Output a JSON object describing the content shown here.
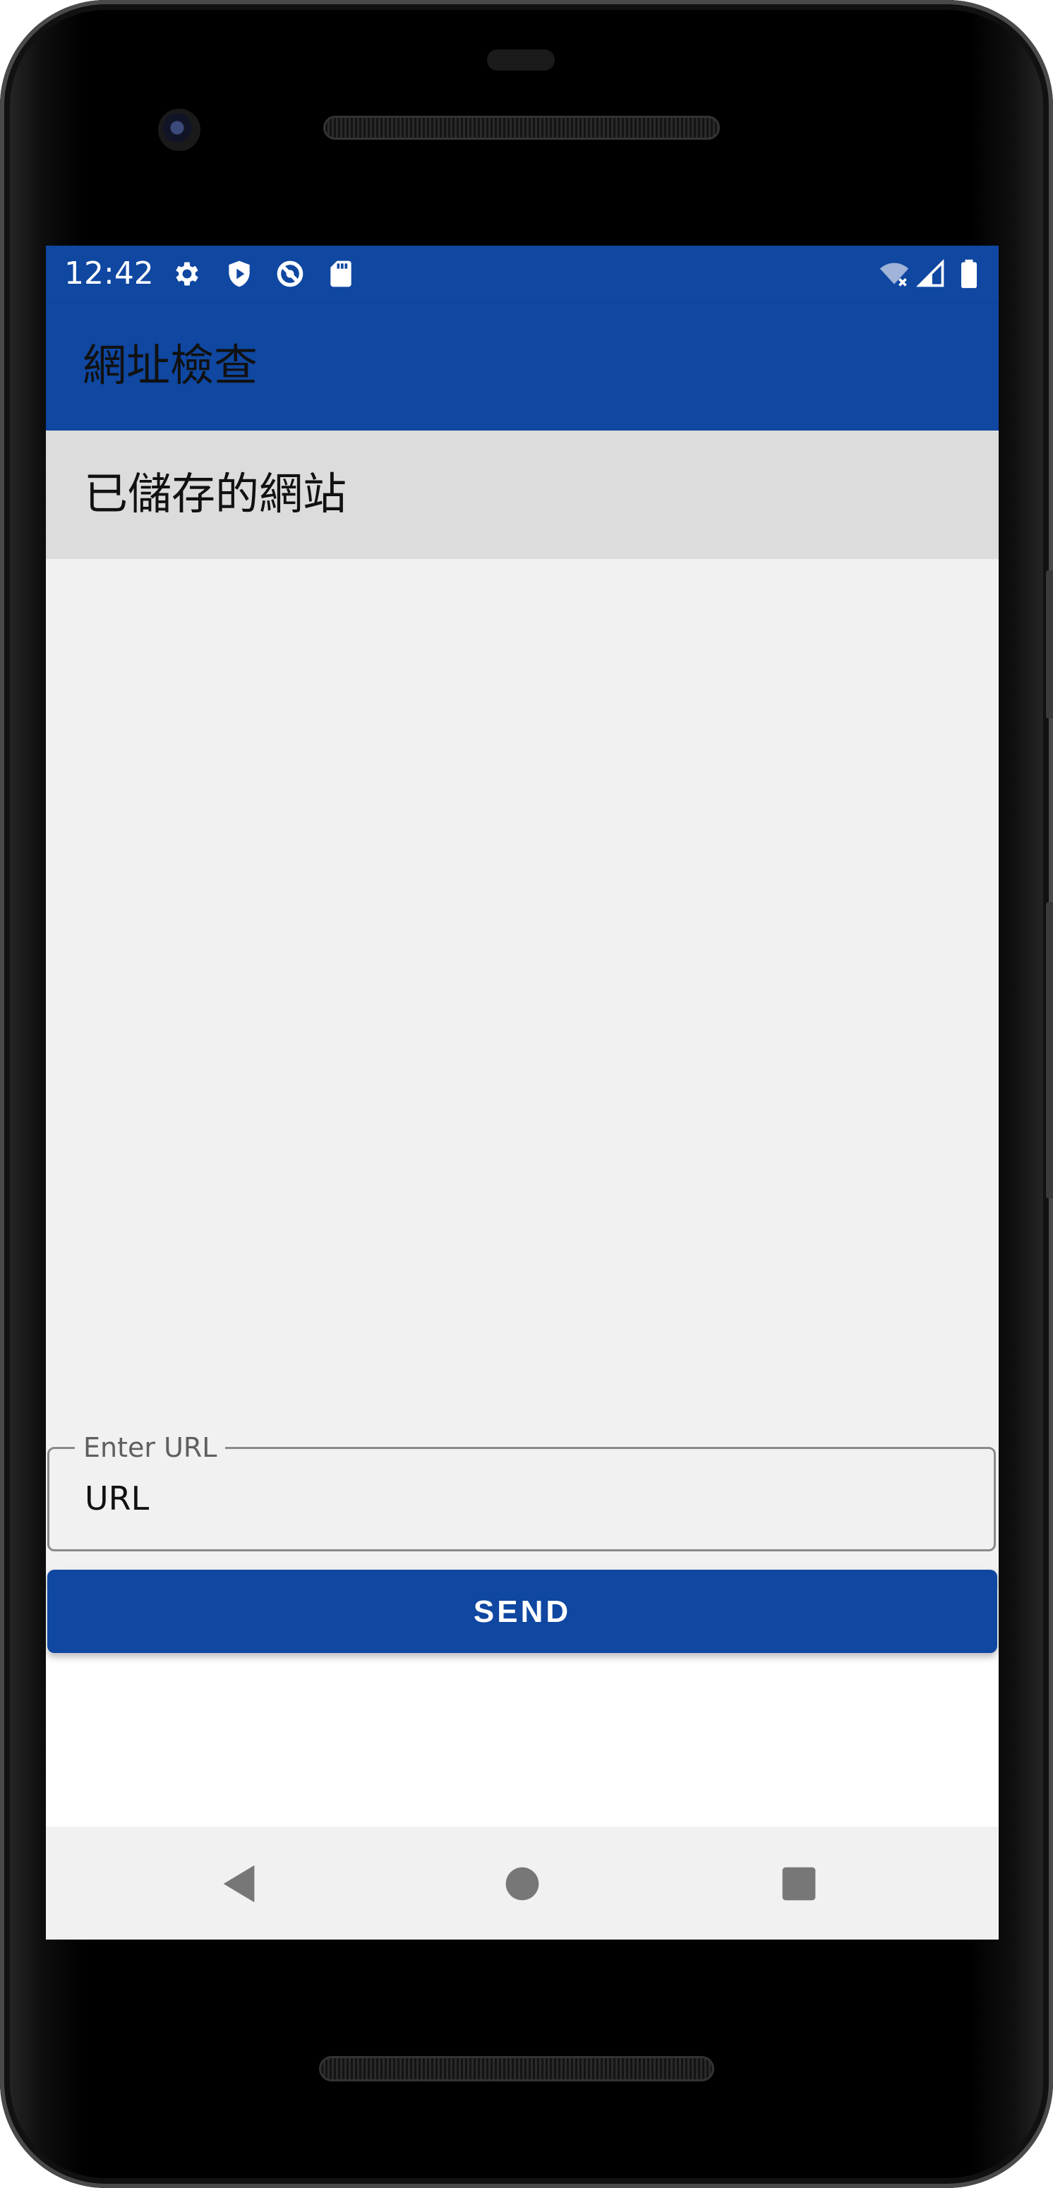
{
  "status_bar": {
    "time": "12:42",
    "left_icons": [
      "settings-icon",
      "shield-play-icon",
      "data-saver-icon",
      "sd-card-icon"
    ],
    "right_icons": [
      "wifi-icon",
      "cellular-signal-icon",
      "battery-icon"
    ]
  },
  "app_bar": {
    "title": "網址檢查"
  },
  "saved_sites": {
    "header": "已儲存的網站",
    "items": []
  },
  "url_form": {
    "label": "Enter URL",
    "value": "URL",
    "send_label": "SEND"
  },
  "nav_bar": {
    "icons": [
      "back-icon",
      "home-icon",
      "recents-icon"
    ]
  },
  "colors": {
    "primary": "#0f47a1",
    "header_bg": "#dcdcdc",
    "list_bg": "#f1f1f1",
    "text": "#111111"
  }
}
